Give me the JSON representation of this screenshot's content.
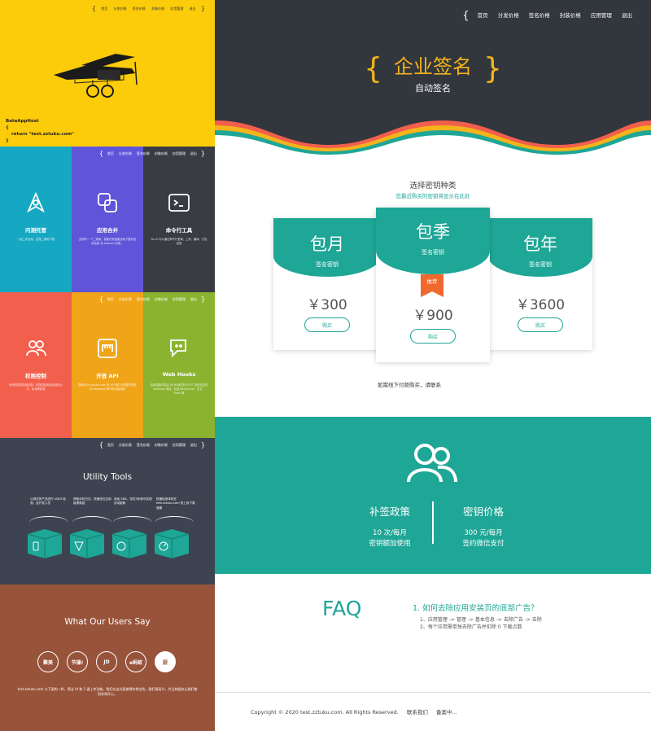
{
  "nav": {
    "items": [
      "首页",
      "分发价格",
      "签名价格",
      "封装价格",
      "应用管理",
      "退出"
    ]
  },
  "panel_yellow": {
    "code": [
      "BetaAppHost",
      "{",
      "return \"test.zztuku.com\"",
      "}"
    ]
  },
  "features": [
    {
      "title": "内测托管",
      "desc": "一键上传应用，扫描二维码下载",
      "color": "#16a8c2"
    },
    {
      "title": "应用合并",
      "desc": "支持同一 个二维码，智能识别设备自动下载对应的应用 包 Android 应用。",
      "color": "#5f55d9"
    },
    {
      "title": "命令行工具",
      "desc": "Fir-cli 可以通过命令行查询、上传、编译、打包应用",
      "color": "#393c42"
    },
    {
      "title": "权限控制",
      "desc": "系统的权限控制机制，可提供应用及应用的公开、私有等权限",
      "color": "#f25f4d"
    },
    {
      "title": "开放 API",
      "desc": "简单的 fir.zztuku.com 的 API 接口为您提供更多的 Webhook 等开放功能调用",
      "color": "#f0a418"
    },
    {
      "title": "Web Hooks",
      "desc": "应用更新时发送 JSON 格式的 POST 请求至您的 webhook 地址，包括 BearyChat、钉钉、Slack 等",
      "color": "#8bb330"
    }
  ],
  "utility": {
    "title": "Utility Tools",
    "items": [
      "以测试的产品进行 UDID 检测，及开发人员",
      "获取手机日志，快速定位应用崩溃原因",
      "添加 SDK，仅仅3步即可实现自动更新",
      "快速检测本机在 test.zztuku.com 的上传下载速度"
    ]
  },
  "testimonials": {
    "title": "What Our Users Say",
    "logos": [
      "聚美",
      "节操!",
      "JD",
      "e蚂蚁",
      "厨"
    ],
    "quote": "test.zztuku.com 与下面的一样，简洁 UI 和 1 键上传功能，我们在这方面做得非常出色，我们很高兴，并且其服务让我们感到非常开心。"
  },
  "hero": {
    "title": "企业签名",
    "subtitle": "自动签名"
  },
  "pricing": {
    "heading": "选择密钥种类",
    "hint": "您最近购买的密钥将显示在此处",
    "key_label": "签名密钥",
    "buy_label": "购买",
    "recommend": "推荐",
    "plans": [
      {
        "name": "包月",
        "price": "￥300"
      },
      {
        "name": "包季",
        "price": "￥900"
      },
      {
        "name": "包年",
        "price": "￥3600"
      }
    ],
    "offline": "如需线下付款购买，请联系"
  },
  "policy": {
    "left": {
      "title": "补签政策",
      "lines": [
        "10 次/每月",
        "密钥额加使用"
      ]
    },
    "right": {
      "title": "密钥价格",
      "lines": [
        "300 元/每月",
        "签约微信支付"
      ]
    }
  },
  "faq": {
    "title": "FAQ",
    "question": "1. 如何去除应用安装页的底部广告？",
    "answers": [
      "1、应用管理 -> 管理 -> 基本信息 -> 去除广告 -> 去除",
      "2、每个应用需单独去除广告并扣除 0 下载点数"
    ]
  },
  "footer": {
    "copyright": "Copyright © 2020 test.zztuku.com. All Rights Reserved.",
    "contact": "联系我们",
    "icp": "备案中..."
  }
}
